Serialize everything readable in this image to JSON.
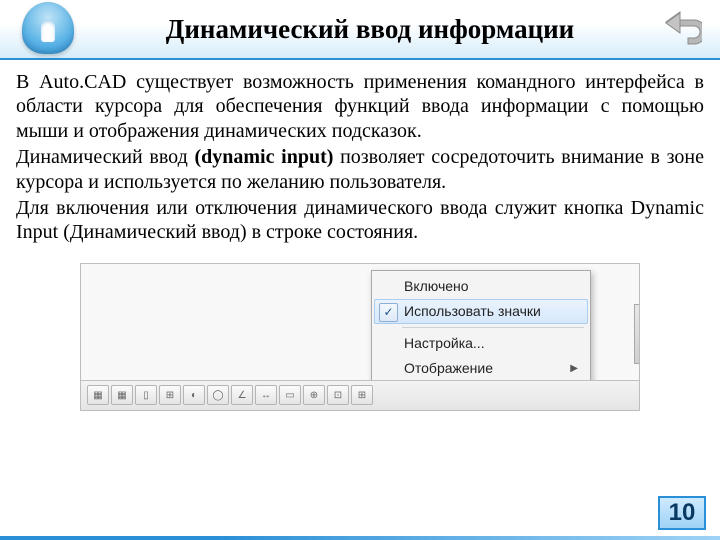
{
  "title": "Динамический ввод информации",
  "paragraphs": {
    "p1": "В Auto.CAD существует возможность применения командного интерфейса в области курсора для обеспечения функций ввода информации с помощью мыши и отображения динамических подсказок.",
    "p2_a": "Динамический ввод ",
    "p2_b": "(dynamic input)",
    "p2_c": " позволяет сосредоточить внимание в зоне курсора и используется по желанию пользователя.",
    "p3": "Для включения или отключения динамического ввода служит кнопка Dynamic Input (Динамический ввод) в строке состояния."
  },
  "menu": {
    "enabled": "Включено",
    "use_icons": "Использовать значки",
    "settings": "Настройка...",
    "display": "Отображение"
  },
  "statusbar_icons": [
    "▦",
    "▦",
    "▯",
    "⊞",
    "◐",
    "◯",
    "∠",
    "↔",
    "▭",
    "⊕",
    "⊡",
    "⊞"
  ],
  "page_number": "10"
}
